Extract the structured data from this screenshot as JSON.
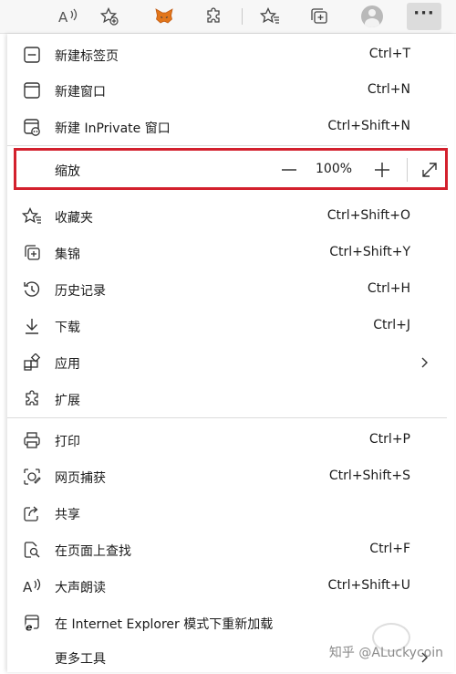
{
  "toolbar": {
    "buttons": [
      "read-aloud-icon",
      "favorite-add-icon",
      "metamask-icon",
      "extensions-icon",
      "favorites-icon",
      "collections-icon",
      "profile-avatar",
      "more-menu"
    ]
  },
  "menu": {
    "new_tab": {
      "label": "新建标签页",
      "shortcut": "Ctrl+T"
    },
    "new_window": {
      "label": "新建窗口",
      "shortcut": "Ctrl+N"
    },
    "new_inprivate": {
      "label": "新建 InPrivate 窗口",
      "shortcut": "Ctrl+Shift+N"
    },
    "zoom": {
      "label": "缩放",
      "value": "100%"
    },
    "favorites": {
      "label": "收藏夹",
      "shortcut": "Ctrl+Shift+O"
    },
    "collections": {
      "label": "集锦",
      "shortcut": "Ctrl+Shift+Y"
    },
    "history": {
      "label": "历史记录",
      "shortcut": "Ctrl+H"
    },
    "downloads": {
      "label": "下载",
      "shortcut": "Ctrl+J"
    },
    "apps": {
      "label": "应用"
    },
    "extensions": {
      "label": "扩展"
    },
    "print": {
      "label": "打印",
      "shortcut": "Ctrl+P"
    },
    "web_capture": {
      "label": "网页捕获",
      "shortcut": "Ctrl+Shift+S"
    },
    "share": {
      "label": "共享"
    },
    "find_on_page": {
      "label": "在页面上查找",
      "shortcut": "Ctrl+F"
    },
    "read_aloud": {
      "label": "大声朗读",
      "shortcut": "Ctrl+Shift+U"
    },
    "ie_mode": {
      "label": "在 Internet Explorer 模式下重新加载"
    },
    "more_tools": {
      "label": "更多工具"
    }
  },
  "watermark": "知乎 @ALuckycoin",
  "colors": {
    "highlight": "#d3202d",
    "toolbar_bg": "#f7f7f7",
    "metamask": "#e2761b"
  }
}
